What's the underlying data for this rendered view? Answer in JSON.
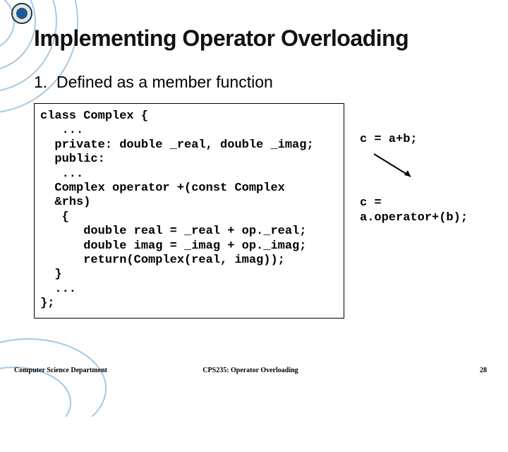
{
  "title": "Implementing Operator Overloading",
  "subtitle": "1.  Defined as a member function",
  "code": "class Complex {\n   ...\n  private: double _real, double _imag;\n  public:\n   ...\n  Complex operator +(const Complex\n  &rhs)\n   {\n      double real = _real + op._real;\n      double imag = _imag + op._imag;\n      return(Complex(real, imag));\n  }\n  ...\n};",
  "side": {
    "expr1": "c = a+b;",
    "expr2a": "c =",
    "expr2b": "a.operator+(b);"
  },
  "footer": {
    "left": "Computer Science Department",
    "center": "CPS235: Operator Overloading",
    "right": "28"
  }
}
